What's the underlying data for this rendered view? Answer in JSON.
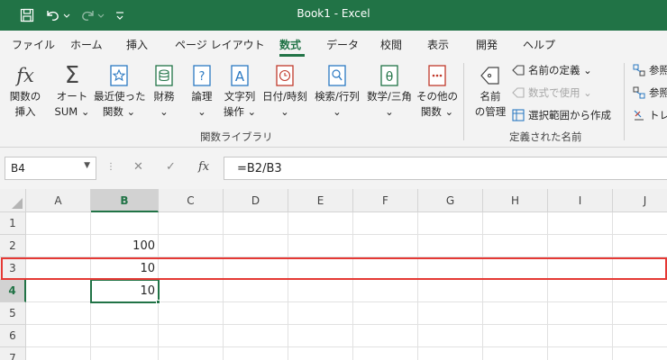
{
  "window": {
    "title": "Book1  -  Excel"
  },
  "tabs": [
    {
      "label": "ファイル"
    },
    {
      "label": "ホーム"
    },
    {
      "label": "挿入"
    },
    {
      "label": "ページ レイアウト"
    },
    {
      "label": "数式"
    },
    {
      "label": "データ"
    },
    {
      "label": "校閲"
    },
    {
      "label": "表示"
    },
    {
      "label": "開発"
    },
    {
      "label": "ヘルプ"
    }
  ],
  "ribbon": {
    "function_library": {
      "group_label": "関数ライブラリ",
      "buttons": [
        {
          "line1": "関数の",
          "line2": "挿入"
        },
        {
          "line1": "オート",
          "line2": "SUM ⌄"
        },
        {
          "line1": "最近使った",
          "line2": "関数 ⌄"
        },
        {
          "line1": "財務",
          "line2": "⌄"
        },
        {
          "line1": "論理",
          "line2": "⌄"
        },
        {
          "line1": "文字列",
          "line2": "操作 ⌄"
        },
        {
          "line1": "日付/時刻",
          "line2": "⌄"
        },
        {
          "line1": "検索/行列",
          "line2": "⌄"
        },
        {
          "line1": "数学/三角",
          "line2": "⌄"
        },
        {
          "line1": "その他の",
          "line2": "関数 ⌄"
        }
      ]
    },
    "defined_names": {
      "group_label": "定義された名前",
      "name_manager": {
        "line1": "名前",
        "line2": "の管理"
      },
      "define_name": "名前の定義  ⌄",
      "use_in_formula": "数式で使用 ⌄",
      "create_from_selection": "選択範囲から作成"
    },
    "formula_auditing": {
      "trace_precedents": "参照",
      "trace_dependents": "参照",
      "remove_arrows": "トレ"
    }
  },
  "formula_bar": {
    "name_box": "B4",
    "formula": "=B2/B3"
  },
  "grid": {
    "columns": [
      "A",
      "B",
      "C",
      "D",
      "E",
      "F",
      "G",
      "H",
      "I",
      "J"
    ],
    "rows": [
      "1",
      "2",
      "3",
      "4",
      "5",
      "6",
      "7"
    ],
    "cells": {
      "B2": "100",
      "B3": "10",
      "B4": "10"
    }
  },
  "colors": {
    "excel_green": "#217346",
    "highlight_red": "#e53935"
  }
}
